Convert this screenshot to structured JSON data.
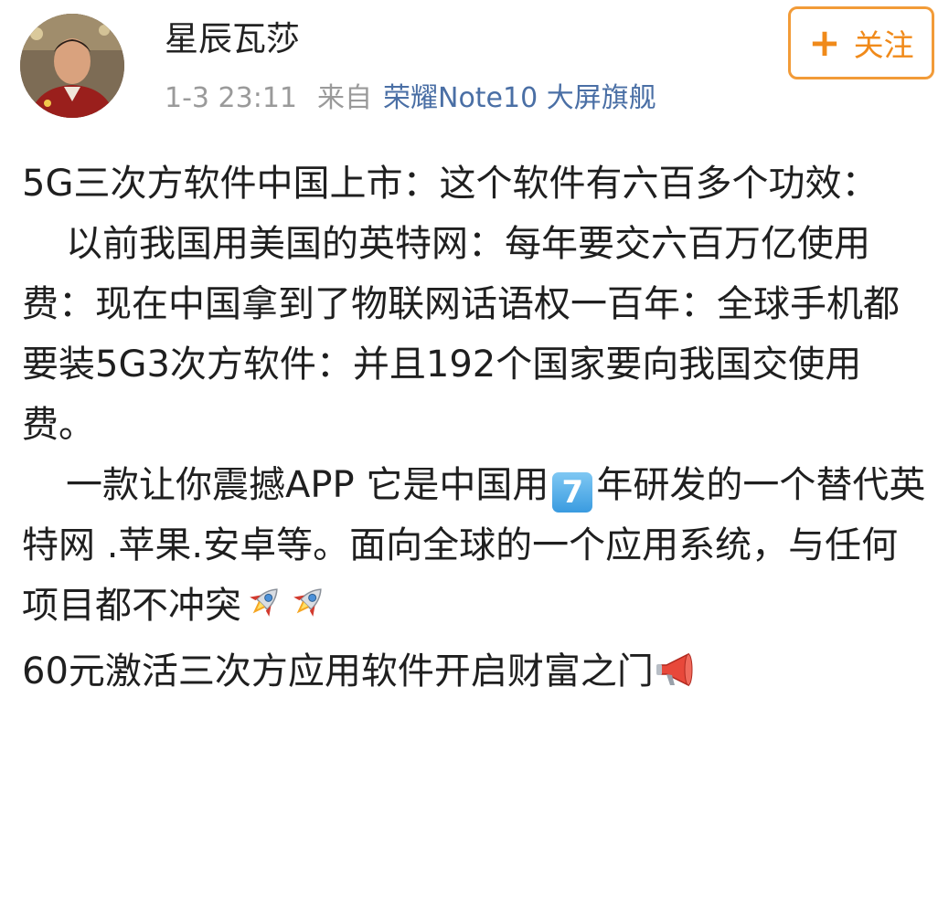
{
  "post": {
    "author": {
      "name": "星辰瓦莎"
    },
    "time": "1-3 23:11",
    "from_label": "来自",
    "device": "荣耀Note10 大屏旗舰",
    "follow_button": {
      "icon": "plus-icon",
      "label": "关注"
    },
    "paragraphs": {
      "p1": "5G三次方软件中国上市：这个软件有六百多个功效：",
      "p2": "以前我国用美国的英特网：每年要交六百万亿使用费：现在中国拿到了物联网话语权一百年：全球手机都要装5G3次方软件：并且192个国家要向我国交使用费。",
      "p3_a": "一款让你震撼APP 它是中国用",
      "p3_emoji": "7",
      "p3_b": "年研发的一个替代英特网 .苹果.安卓等。面向全球的一个应用系统，与任何项目都不冲突",
      "p4": "60元激活三次方应用软件开启财富之门"
    },
    "emojis": {
      "number": "keycap-7-icon",
      "rocket": "rocket-icon",
      "megaphone": "megaphone-icon"
    }
  },
  "colors": {
    "follow_accent": "#f29b38",
    "device_link": "#4a6fa5",
    "meta_gray": "#9a9a9a",
    "text": "#1f1f1f"
  }
}
